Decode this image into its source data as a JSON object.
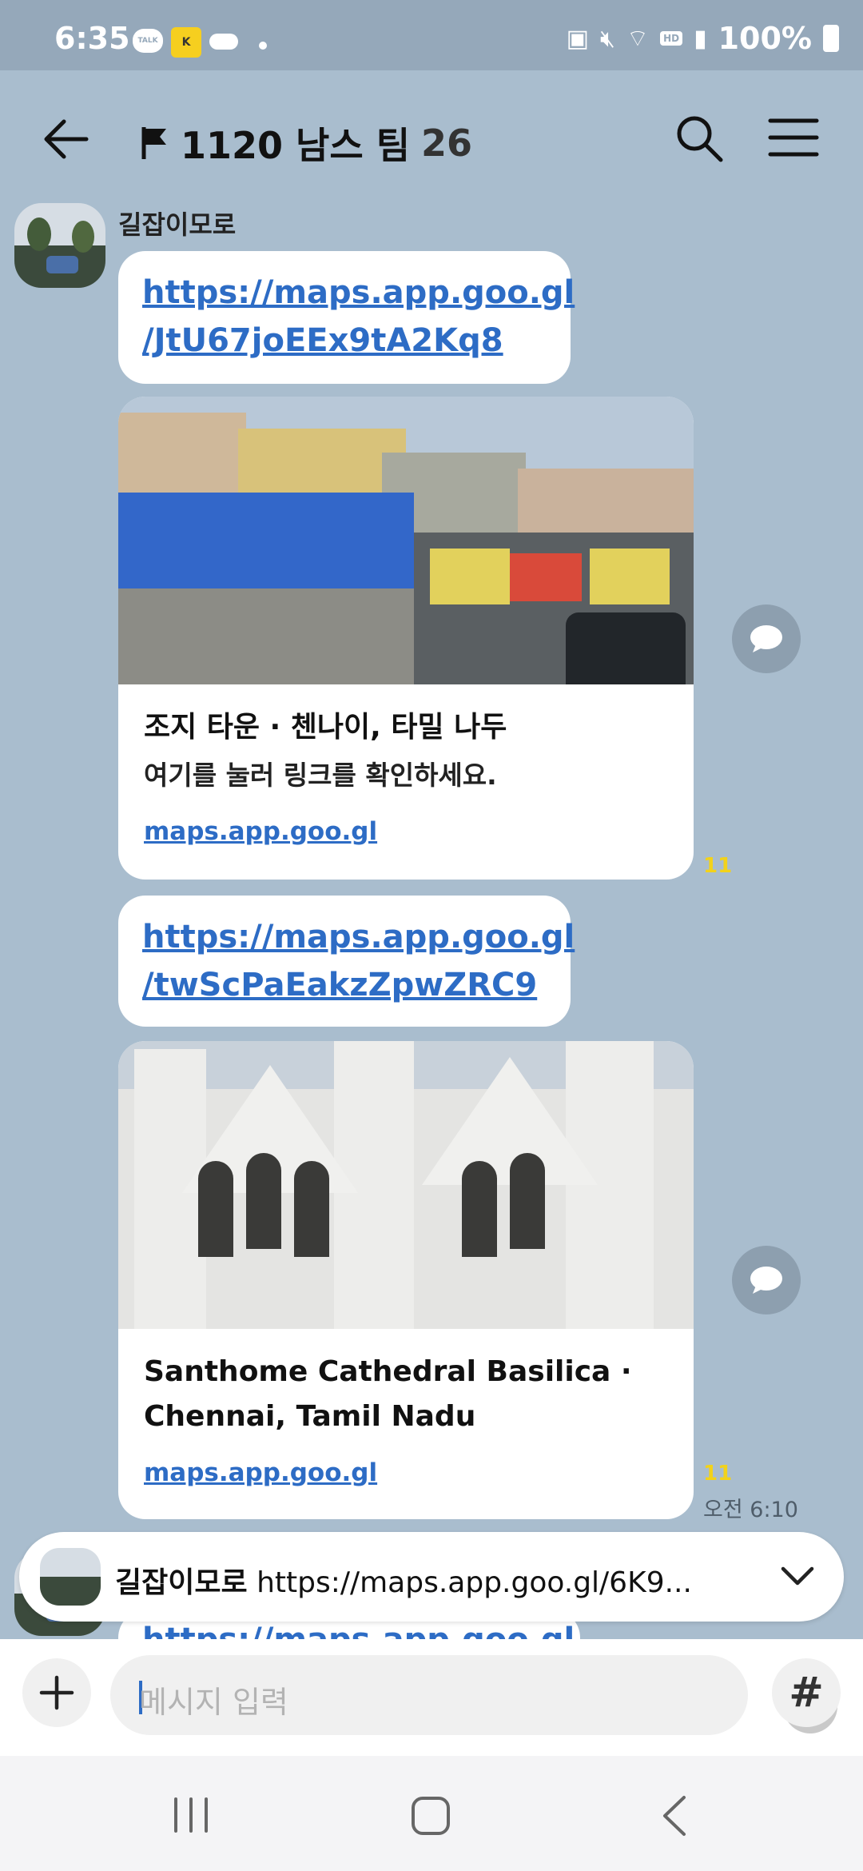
{
  "status_bar": {
    "time": "6:35",
    "talk_badge": "TALK",
    "battery": "100%",
    "hd_voice": "HD"
  },
  "header": {
    "title": "1120  남스 팀",
    "member_count": "26"
  },
  "messages": {
    "sender": "길잡이모로",
    "link1": {
      "line1": "https://maps.app.goo.gl",
      "line2": "/JtU67joEEx9tA2Kq8"
    },
    "card1": {
      "title": "조지 타운 · 첸나이, 타밀 나두",
      "desc": "여기를 눌러 링크를 확인하세요.",
      "domain": "maps.app.goo.gl",
      "unread": "11"
    },
    "link2": {
      "line1": "https://maps.app.goo.gl",
      "line2": "/twScPaEakzZpwZRC9"
    },
    "card2": {
      "title_line1": "Santhome Cathedral Basilica ·",
      "title_line2": "Chennai, Tamil Nadu",
      "domain": "maps.app.goo.gl",
      "unread": "11",
      "time": "오전 6:10"
    },
    "partial_link": "https://maps.app.goo.gl"
  },
  "pinned": {
    "sender": "길잡이모로",
    "text": "https://maps.app.goo.gl/6K9..."
  },
  "input": {
    "placeholder": "메시지 입력",
    "hash_label": "#"
  },
  "colors": {
    "background": "#a9bdce",
    "link": "#2d6cc5",
    "unread": "#f2d21b"
  }
}
